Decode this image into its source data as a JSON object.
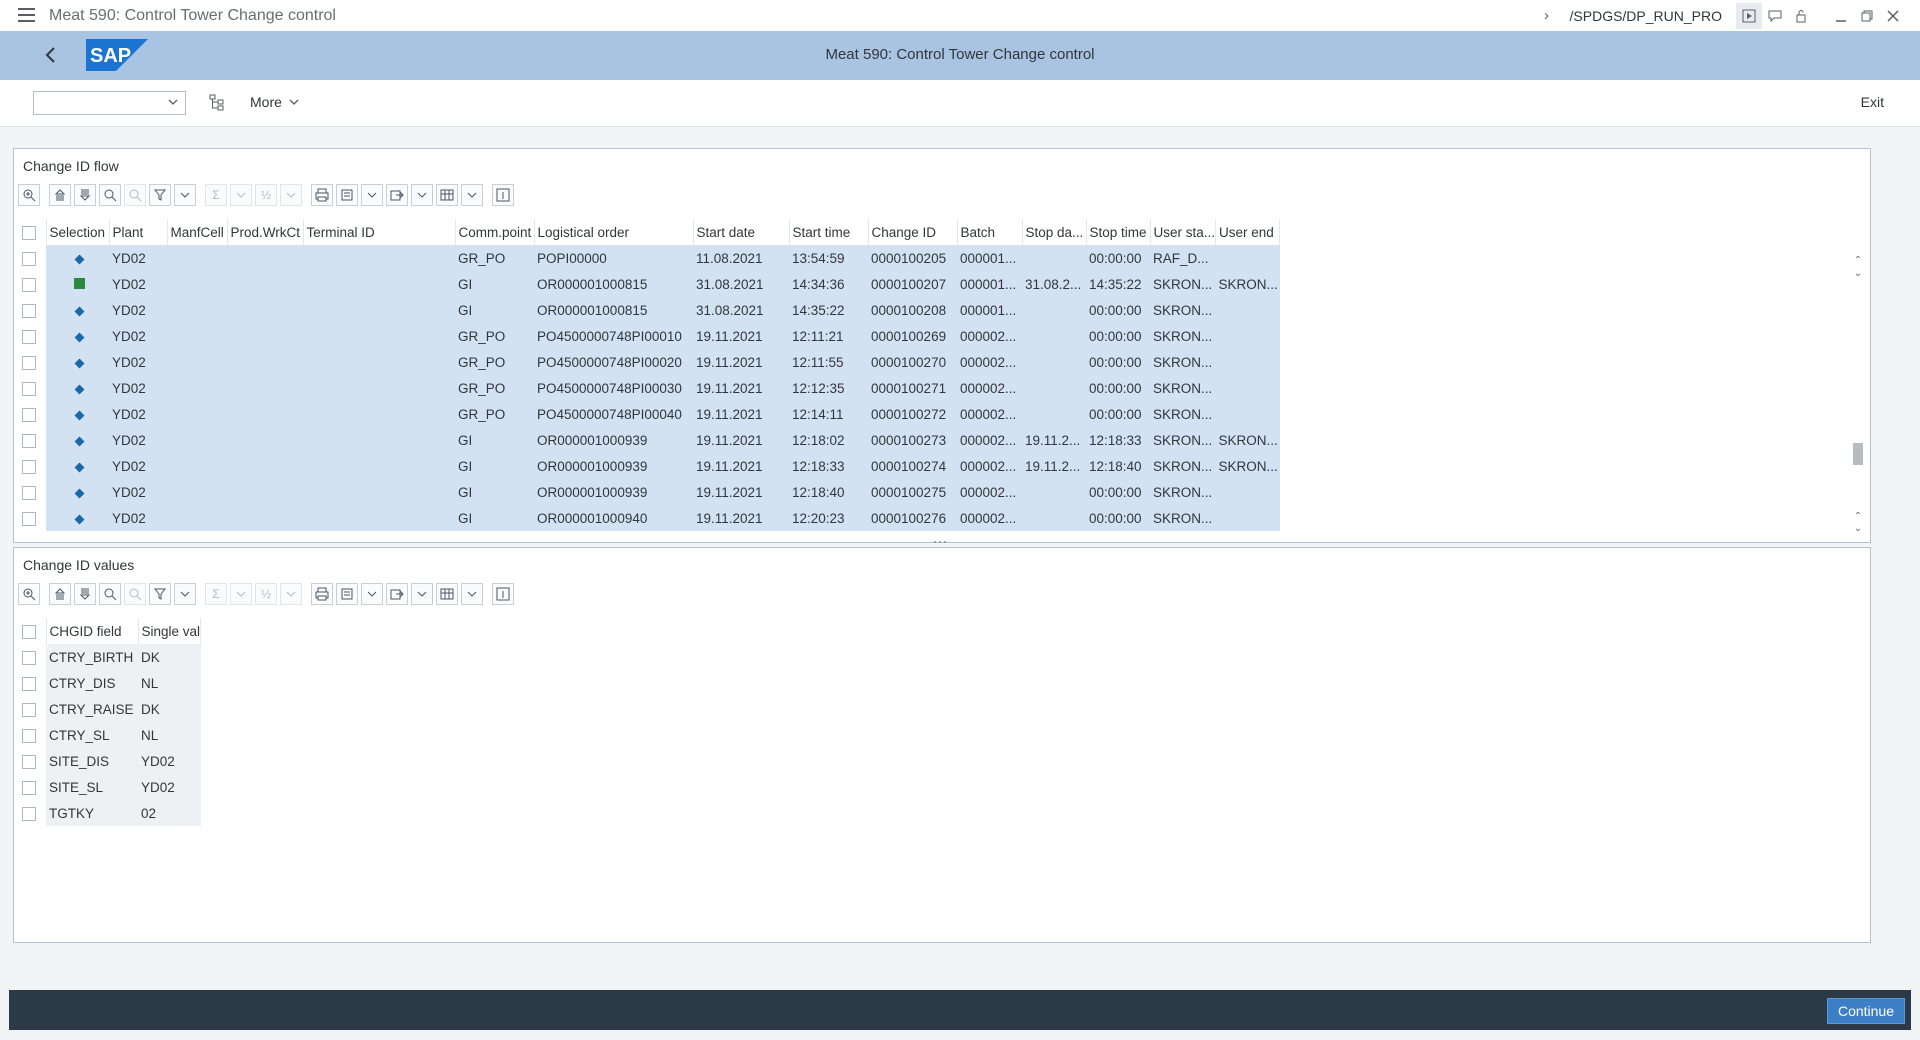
{
  "window": {
    "title": "Meat 590: Control Tower Change control",
    "transaction": "/SPDGS/DP_RUN_PRO"
  },
  "shell": {
    "title": "Meat 590: Control Tower Change control",
    "logo_text": "SAP"
  },
  "toolbar": {
    "combo_value": "",
    "more_label": "More",
    "exit_label": "Exit"
  },
  "flow": {
    "title": "Change ID flow",
    "headers": [
      "Selection",
      "Plant",
      "ManfCell",
      "Prod.WrkCt",
      "Terminal ID",
      "Comm.point",
      "Logistical order",
      "Start date",
      "Start time",
      "Change ID",
      "Batch",
      "Stop da...",
      "Stop time",
      "User sta...",
      "User end"
    ],
    "rows": [
      {
        "status": "diamond",
        "plant": "YD02",
        "manf": "",
        "prod": "",
        "term": "",
        "comm": "GR_PO",
        "order": "POPI00000",
        "sdate": "11.08.2021",
        "stime": "13:54:59",
        "chg": "0000100205",
        "batch": "000001...",
        "stopd": "",
        "stopt": "00:00:00",
        "ustart": "RAF_D...",
        "uend": ""
      },
      {
        "status": "square",
        "plant": "YD02",
        "manf": "",
        "prod": "",
        "term": "",
        "comm": "GI",
        "order": "OR000001000815",
        "sdate": "31.08.2021",
        "stime": "14:34:36",
        "chg": "0000100207",
        "batch": "000001...",
        "stopd": "31.08.2...",
        "stopt": "14:35:22",
        "ustart": "SKRON...",
        "uend": "SKRON..."
      },
      {
        "status": "diamond",
        "plant": "YD02",
        "manf": "",
        "prod": "",
        "term": "",
        "comm": "GI",
        "order": "OR000001000815",
        "sdate": "31.08.2021",
        "stime": "14:35:22",
        "chg": "0000100208",
        "batch": "000001...",
        "stopd": "",
        "stopt": "00:00:00",
        "ustart": "SKRON...",
        "uend": ""
      },
      {
        "status": "diamond",
        "plant": "YD02",
        "manf": "",
        "prod": "",
        "term": "",
        "comm": "GR_PO",
        "order": "PO4500000748PI00010",
        "sdate": "19.11.2021",
        "stime": "12:11:21",
        "chg": "0000100269",
        "batch": "000002...",
        "stopd": "",
        "stopt": "00:00:00",
        "ustart": "SKRON...",
        "uend": ""
      },
      {
        "status": "diamond",
        "plant": "YD02",
        "manf": "",
        "prod": "",
        "term": "",
        "comm": "GR_PO",
        "order": "PO4500000748PI00020",
        "sdate": "19.11.2021",
        "stime": "12:11:55",
        "chg": "0000100270",
        "batch": "000002...",
        "stopd": "",
        "stopt": "00:00:00",
        "ustart": "SKRON...",
        "uend": ""
      },
      {
        "status": "diamond",
        "plant": "YD02",
        "manf": "",
        "prod": "",
        "term": "",
        "comm": "GR_PO",
        "order": "PO4500000748PI00030",
        "sdate": "19.11.2021",
        "stime": "12:12:35",
        "chg": "0000100271",
        "batch": "000002...",
        "stopd": "",
        "stopt": "00:00:00",
        "ustart": "SKRON...",
        "uend": ""
      },
      {
        "status": "diamond",
        "plant": "YD02",
        "manf": "",
        "prod": "",
        "term": "",
        "comm": "GR_PO",
        "order": "PO4500000748PI00040",
        "sdate": "19.11.2021",
        "stime": "12:14:11",
        "chg": "0000100272",
        "batch": "000002...",
        "stopd": "",
        "stopt": "00:00:00",
        "ustart": "SKRON...",
        "uend": ""
      },
      {
        "status": "diamond",
        "plant": "YD02",
        "manf": "",
        "prod": "",
        "term": "",
        "comm": "GI",
        "order": "OR000001000939",
        "sdate": "19.11.2021",
        "stime": "12:18:02",
        "chg": "0000100273",
        "batch": "000002...",
        "stopd": "19.11.2...",
        "stopt": "12:18:33",
        "ustart": "SKRON...",
        "uend": "SKRON..."
      },
      {
        "status": "diamond",
        "plant": "YD02",
        "manf": "",
        "prod": "",
        "term": "",
        "comm": "GI",
        "order": "OR000001000939",
        "sdate": "19.11.2021",
        "stime": "12:18:33",
        "chg": "0000100274",
        "batch": "000002...",
        "stopd": "19.11.2...",
        "stopt": "12:18:40",
        "ustart": "SKRON...",
        "uend": "SKRON..."
      },
      {
        "status": "diamond",
        "plant": "YD02",
        "manf": "",
        "prod": "",
        "term": "",
        "comm": "GI",
        "order": "OR000001000939",
        "sdate": "19.11.2021",
        "stime": "12:18:40",
        "chg": "0000100275",
        "batch": "000002...",
        "stopd": "",
        "stopt": "00:00:00",
        "ustart": "SKRON...",
        "uend": ""
      },
      {
        "status": "diamond",
        "plant": "YD02",
        "manf": "",
        "prod": "",
        "term": "",
        "comm": "GI",
        "order": "OR000001000940",
        "sdate": "19.11.2021",
        "stime": "12:20:23",
        "chg": "0000100276",
        "batch": "000002...",
        "stopd": "",
        "stopt": "00:00:00",
        "ustart": "SKRON...",
        "uend": ""
      }
    ]
  },
  "values": {
    "title": "Change ID values",
    "headers": [
      "CHGID field",
      "Single val"
    ],
    "rows": [
      {
        "field": "CTRY_BIRTH",
        "val": "DK"
      },
      {
        "field": "CTRY_DIS",
        "val": "NL"
      },
      {
        "field": "CTRY_RAISE",
        "val": "DK"
      },
      {
        "field": "CTRY_SL",
        "val": "NL"
      },
      {
        "field": "SITE_DIS",
        "val": "YD02"
      },
      {
        "field": "SITE_SL",
        "val": "YD02"
      },
      {
        "field": "TGTKY",
        "val": "02"
      }
    ]
  },
  "footer": {
    "continue_label": "Continue"
  },
  "colors": {
    "shell": "#a9c4e2",
    "selection": "#d3e2f3",
    "status_diamond": "#1a6aa8",
    "status_square": "#2b8a3e",
    "footer": "#2c3a47",
    "button": "#3d7fc6"
  }
}
